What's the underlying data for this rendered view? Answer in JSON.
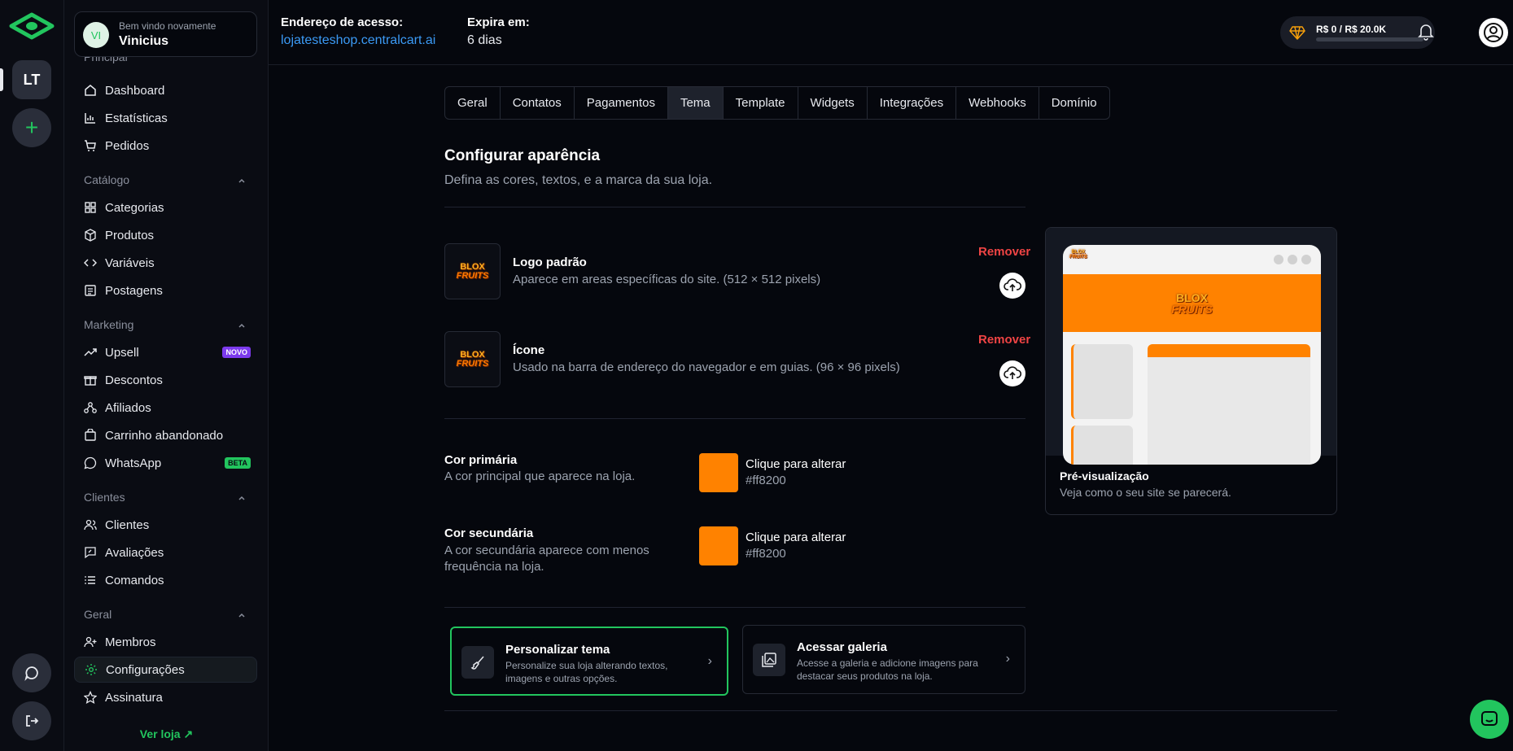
{
  "rail": {
    "store_initials": "LT",
    "add_symbol": "+",
    "icons": [
      "app-logo-icon",
      "chat-icon",
      "logout-icon"
    ]
  },
  "sidebar": {
    "welcome_label": "Bem vindo novamente",
    "user_name": "Vinicius",
    "user_initials": "VI",
    "partial_section": "Principal",
    "sections": {
      "catalogo": "Catálogo",
      "marketing": "Marketing",
      "clientes": "Clientes",
      "geral": "Geral"
    },
    "items": {
      "dashboard": "Dashboard",
      "estatisticas": "Estatísticas",
      "pedidos": "Pedidos",
      "categorias": "Categorias",
      "produtos": "Produtos",
      "variaveis": "Variáveis",
      "postagens": "Postagens",
      "upsell": "Upsell",
      "descontos": "Descontos",
      "afiliados": "Afiliados",
      "carrinho": "Carrinho abandonado",
      "whatsapp": "WhatsApp",
      "clientes": "Clientes",
      "avaliacoes": "Avaliações",
      "comandos": "Comandos",
      "membros": "Membros",
      "configuracoes": "Configurações",
      "assinatura": "Assinatura"
    },
    "badges": {
      "novo": "NOVO",
      "beta": "BETA"
    },
    "ver_loja": "Ver loja ↗"
  },
  "topbar": {
    "address_label": "Endereço de acesso:",
    "address_link": "lojatesteshop.centralcart.ai",
    "expires_label": "Expira em:",
    "expires_value": "6 dias",
    "balance_text": "R$ 0 / R$ 20.0K",
    "balance_progress": 0
  },
  "tabs": [
    "Geral",
    "Contatos",
    "Pagamentos",
    "Tema",
    "Template",
    "Widgets",
    "Integrações",
    "Webhooks",
    "Domínio"
  ],
  "active_tab": "Tema",
  "appearance": {
    "title": "Configurar aparência",
    "subtitle": "Defina as cores, textos, e a marca da sua loja.",
    "logo_title": "Logo padrão",
    "logo_desc": "Aparece em areas específicas do site. (512 × 512 pixels)",
    "icon_title": "Ícone",
    "icon_desc": "Usado na barra de endereço do navegador e em guias. (96 × 96 pixels)",
    "remove_label": "Remover",
    "brand_line1": "BLOX",
    "brand_line2": "FRUITS"
  },
  "colors": {
    "primary_title": "Cor primária",
    "primary_desc": "A cor principal que aparece na loja.",
    "secondary_title": "Cor secundária",
    "secondary_desc": "A cor secundária aparece com menos frequência na loja.",
    "change_label": "Clique para alterar",
    "primary_hex": "#ff8200",
    "secondary_hex": "#ff8200"
  },
  "cards": {
    "customize_title": "Personalizar tema",
    "customize_desc": "Personalize sua loja alterando textos, imagens e outras opções.",
    "gallery_title": "Acessar galeria",
    "gallery_desc": "Acesse a galeria e adicione imagens para destacar seus produtos na loja."
  },
  "preview": {
    "title": "Pré-visualização",
    "desc": "Veja como o seu site se parecerá."
  },
  "accent_color": "#22c55e"
}
